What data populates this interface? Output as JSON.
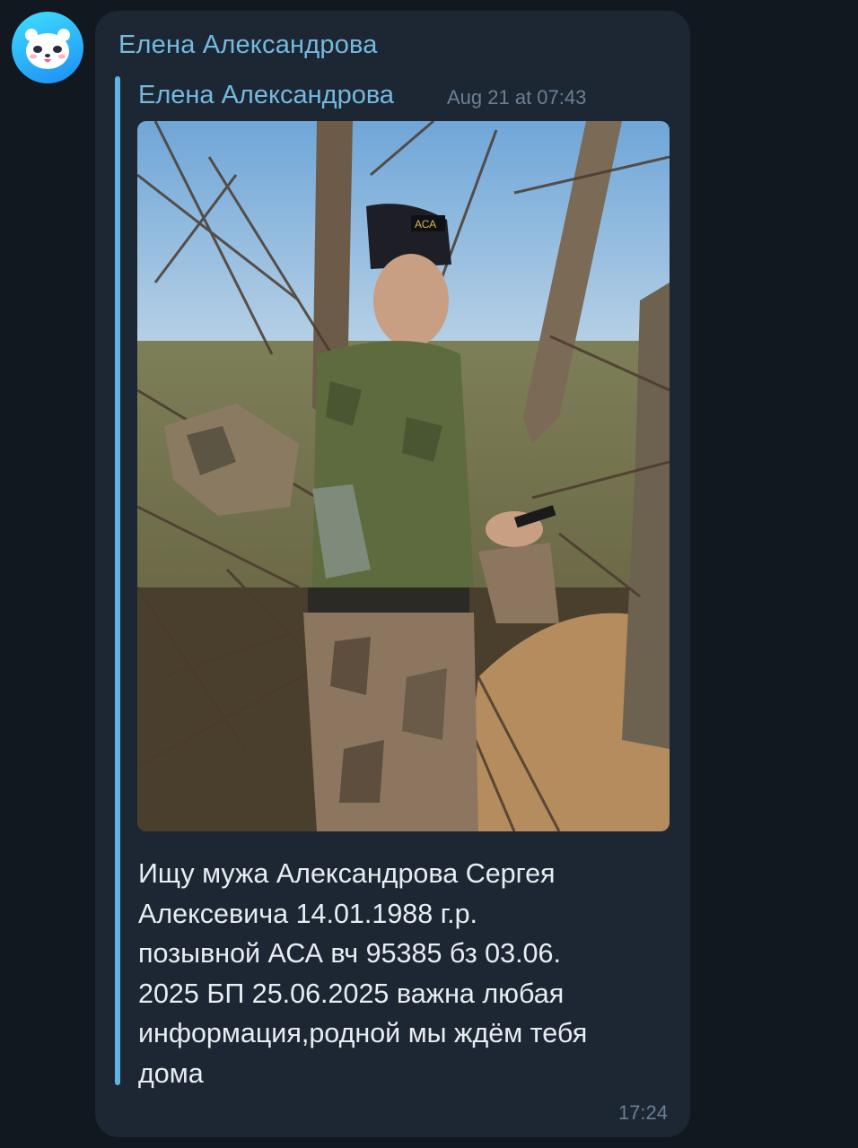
{
  "sender": {
    "name": "Елена Александрова",
    "avatar_icon": "panda-avatar-icon"
  },
  "message": {
    "forwarded_from": {
      "name": "Елена Александрова",
      "date": "Aug 21 at 07:43"
    },
    "photo": {
      "description_icon": "photo-icon",
      "cap_text": "АСА"
    },
    "text": "Ищу мужа Александрова Сергея\nАлексевича 14.01.1988 г.р.\nпозывной АСА вч 95385 бз 03.06.\n2025 БП 25.06.2025 важна любая\nинформация,родной мы ждём тебя\nдома",
    "time": "17:24"
  },
  "colors": {
    "background": "#111820",
    "bubble": "#1d2733",
    "accent": "#74b9e0",
    "forward_bar": "#5fb4e3",
    "text": "#e8edf2",
    "meta": "#6b7f93"
  }
}
